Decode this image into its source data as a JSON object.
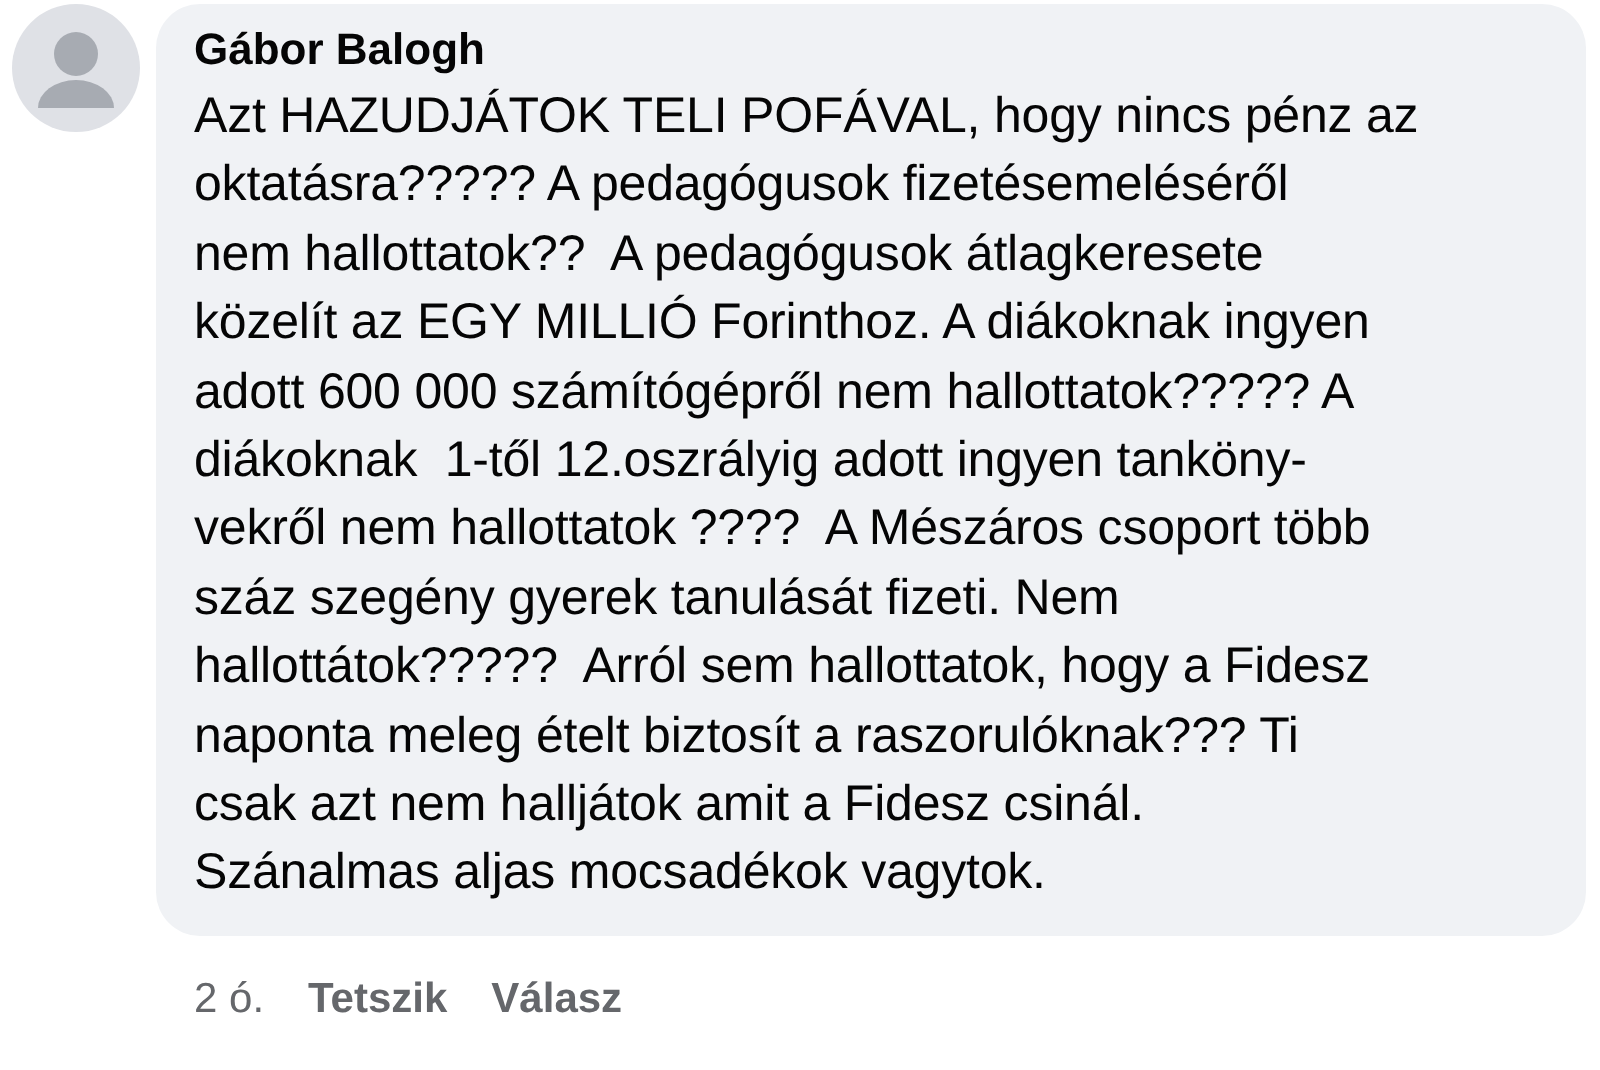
{
  "comment": {
    "author": "Gábor Balogh",
    "text": "Azt HAZUDJÁTOK TELI POFÁVAL, hogy nincs pénz az\noktatásra????? A pedagógusok fizetésemeléséről\nnem hallottatok??  A pedagógusok átlagkeresete\nközelít az EGY MILLIÓ Forinthoz. A diákoknak ingyen\nadott 600 000 számítógépről nem hallottatok????? A\ndiákoknak  1-től 12.oszrályig adott ingyen tanköny-\nvekről nem hallottatok ????  A Mészáros csoport több\nszáz szegény gyerek tanulását fizeti. Nem\nhallottátok?????  Arról sem hallottatok, hogy a Fidesz\nnaponta meleg ételt biztosít a raszorulóknak??? Ti\ncsak azt nem halljátok amit a Fidesz csinál.\nSzánalmas aljas mocsadékok vagytok.",
    "time": "2 ó.",
    "actions": [
      "Tetszik",
      "Válasz"
    ]
  }
}
